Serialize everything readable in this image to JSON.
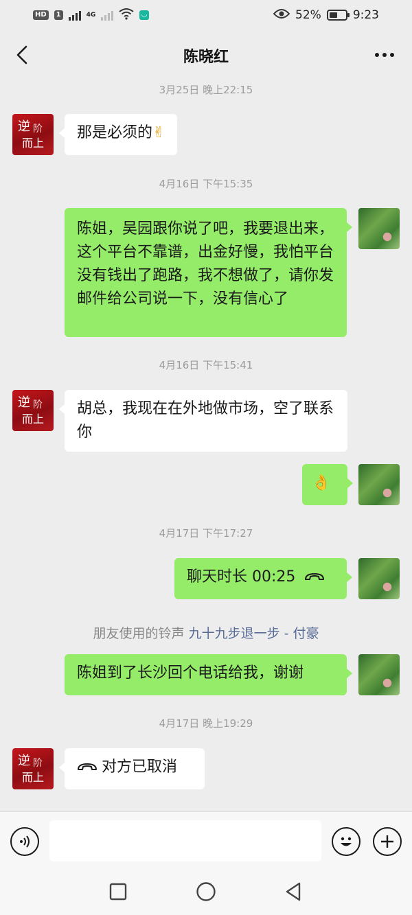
{
  "status_bar": {
    "hd": "HD",
    "sim": "1",
    "network": "4G",
    "battery_percent": "52%",
    "battery_level": 0.52,
    "time": "9:23"
  },
  "header": {
    "title": "陈晓红",
    "back_icon": "chevron-left-icon",
    "more_icon": "more-dots-icon"
  },
  "chat": {
    "timestamps": [
      "3月25日 晚上22:15",
      "4月16日 下午15:35",
      "4月16日 下午15:41",
      "4月17日 下午17:27",
      "4月17日 晚上19:29"
    ],
    "messages": [
      {
        "side": "left",
        "text": "那是必须的",
        "emoji": "✌"
      },
      {
        "side": "right",
        "text": "陈姐，吴园跟你说了吧，我要退出来，这个平台不靠谱，出金好慢，我怕平台没有钱出了跑路，我不想做了，请你发邮件给公司说一下，没有信心了"
      },
      {
        "side": "left",
        "text": "胡总，我现在在外地做市场，空了联系你"
      },
      {
        "side": "right",
        "emoji": "👌"
      },
      {
        "side": "right",
        "text": "聊天时长 00:25",
        "icon": "phone-hangup-icon"
      },
      {
        "side": "right",
        "text": "陈姐到了长沙回个电话给我，谢谢"
      },
      {
        "side": "left",
        "text": "对方已取消",
        "icon": "phone-hangup-icon"
      }
    ],
    "ringtone": {
      "prefix": "朋友使用的铃声",
      "song": "九十九步退一步 - 付豪"
    }
  },
  "input_bar": {
    "voice_icon": "voice-icon",
    "emoji_icon": "emoji-icon",
    "plus_icon": "plus-icon",
    "value": ""
  },
  "system_nav": {
    "recent_icon": "square-icon",
    "home_icon": "circle-icon",
    "back_icon": "triangle-back-icon"
  },
  "colors": {
    "background": "#ededed",
    "bubble_self": "#95ec69",
    "bubble_other": "#ffffff",
    "timestamp": "#9b9b9b",
    "link": "#576b95"
  }
}
